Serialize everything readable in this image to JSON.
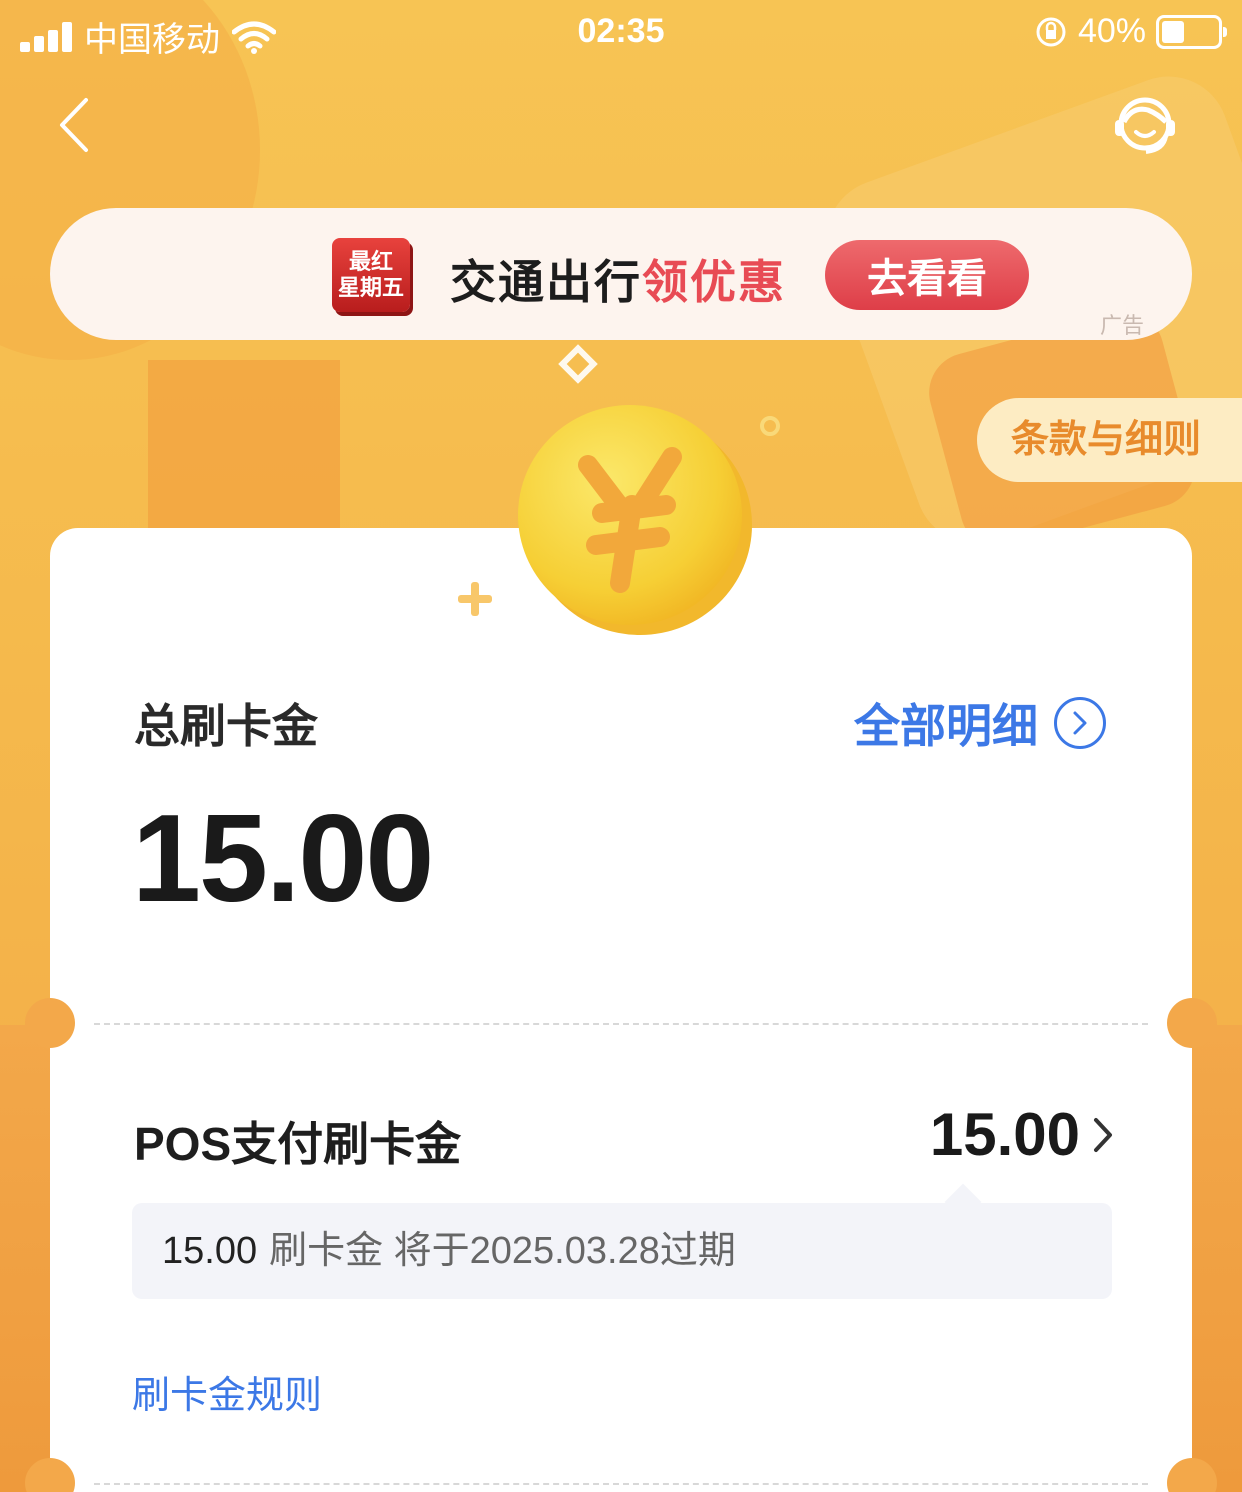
{
  "status_bar": {
    "carrier": "中国移动",
    "time": "02:35",
    "battery": "40%"
  },
  "nav": {
    "back_icon": "chevron-left-icon",
    "service_icon": "customer-service-icon"
  },
  "ad": {
    "logo_line1": "最红",
    "logo_line2": "星期五",
    "text_dark": "交通出行",
    "text_red": "领优惠",
    "button": "去看看",
    "tag": "广告",
    "accent": "#e84b54"
  },
  "terms_label": "条款与细则",
  "card": {
    "total_label": "总刷卡金",
    "details_label": "全部明细",
    "total_amount": "15.00",
    "pos_label": "POS支付刷卡金",
    "pos_amount": "15.00",
    "expire_amount": "15.00",
    "expire_text": "刷卡金 将于2025.03.28过期",
    "rules_link": "刷卡金规则"
  },
  "colors": {
    "brand_blue": "#3c78e6",
    "background_orange": "#f5b94c"
  }
}
